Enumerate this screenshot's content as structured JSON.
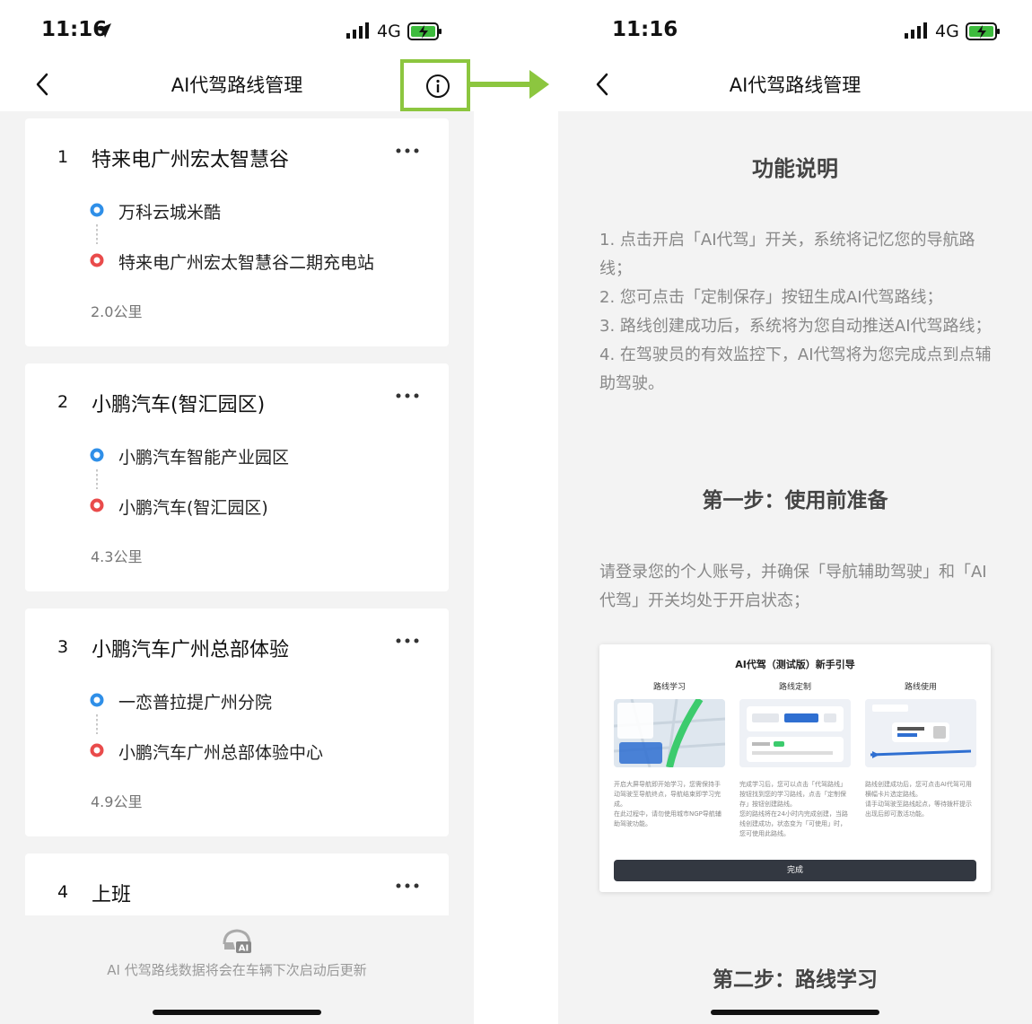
{
  "left": {
    "status": {
      "time": "11:16",
      "network": "4G"
    },
    "nav": {
      "title": "AI代驾路线管理"
    },
    "routes": [
      {
        "index": "1",
        "name": "特来电广州宏太智慧谷",
        "start": "万科云城米酷",
        "end": "特来电广州宏太智慧谷二期充电站",
        "distance": "2.0公里"
      },
      {
        "index": "2",
        "name": "小鹏汽车(智汇园区)",
        "start": "小鹏汽车智能产业园区",
        "end": "小鹏汽车(智汇园区)",
        "distance": "4.3公里"
      },
      {
        "index": "3",
        "name": "小鹏汽车广州总部体验",
        "start": "一恋普拉提广州分院",
        "end": "小鹏汽车广州总部体验中心",
        "distance": "4.9公里"
      },
      {
        "index": "4",
        "name": "上班"
      }
    ],
    "footer_note": "AI 代驾路线数据将会在车辆下次启动后更新"
  },
  "right": {
    "status": {
      "time": "11:16",
      "network": "4G"
    },
    "nav": {
      "title": "AI代驾路线管理"
    },
    "func_title": "功能说明",
    "func_paragraph": "1. 点击开启「AI代驾」开关，系统将记忆您的导航路线；\n2. 您可点击「定制保存」按钮生成AI代驾路线；\n3. 路线创建成功后，系统将为您自动推送AI代驾路线；\n4. 在驾驶员的有效监控下，AI代驾将为您完成点到点辅助驾驶。",
    "step1_title": "第一步：使用前准备",
    "step1_paragraph": "请登录您的个人账号，并确保「导航辅助驾驶」和「AI代驾」开关均处于开启状态；",
    "guide": {
      "title": "AI代驾（测试版）新手引导",
      "columns": [
        {
          "title": "路线学习",
          "desc": "开启大屏导航即开始学习，您需保持手动驾驶至导航终点，导航结束即学习完成。\n在此过程中，请勿使用城市NGP导航辅助驾驶功能。"
        },
        {
          "title": "路线定制",
          "desc": "完成学习后，您可以点击「代驾路线」按钮找到您的学习路线，点击「定制保存」按钮创建路线。\n您的路线将在24小时内完成创建，当路线创建成功，状态变为「可使用」时，您可使用此路线。"
        },
        {
          "title": "路线使用",
          "desc": "路线创建成功后，您可点击AI代驾可用横幅卡片选定路线。\n请手动驾驶至路线起点，等待拨杆提示出现后即可激活功能。"
        }
      ],
      "done_label": "完成"
    },
    "step2_title": "第二步：路线学习"
  },
  "colors": {
    "accent_green": "#8cc63f",
    "start_blue": "#2f8fe8",
    "end_red": "#e94b4b"
  },
  "icons": [
    "location-arrow-icon",
    "signal-icon",
    "battery-charging-icon",
    "back-chevron-icon",
    "info-icon",
    "more-dots-icon",
    "car-ai-icon"
  ]
}
